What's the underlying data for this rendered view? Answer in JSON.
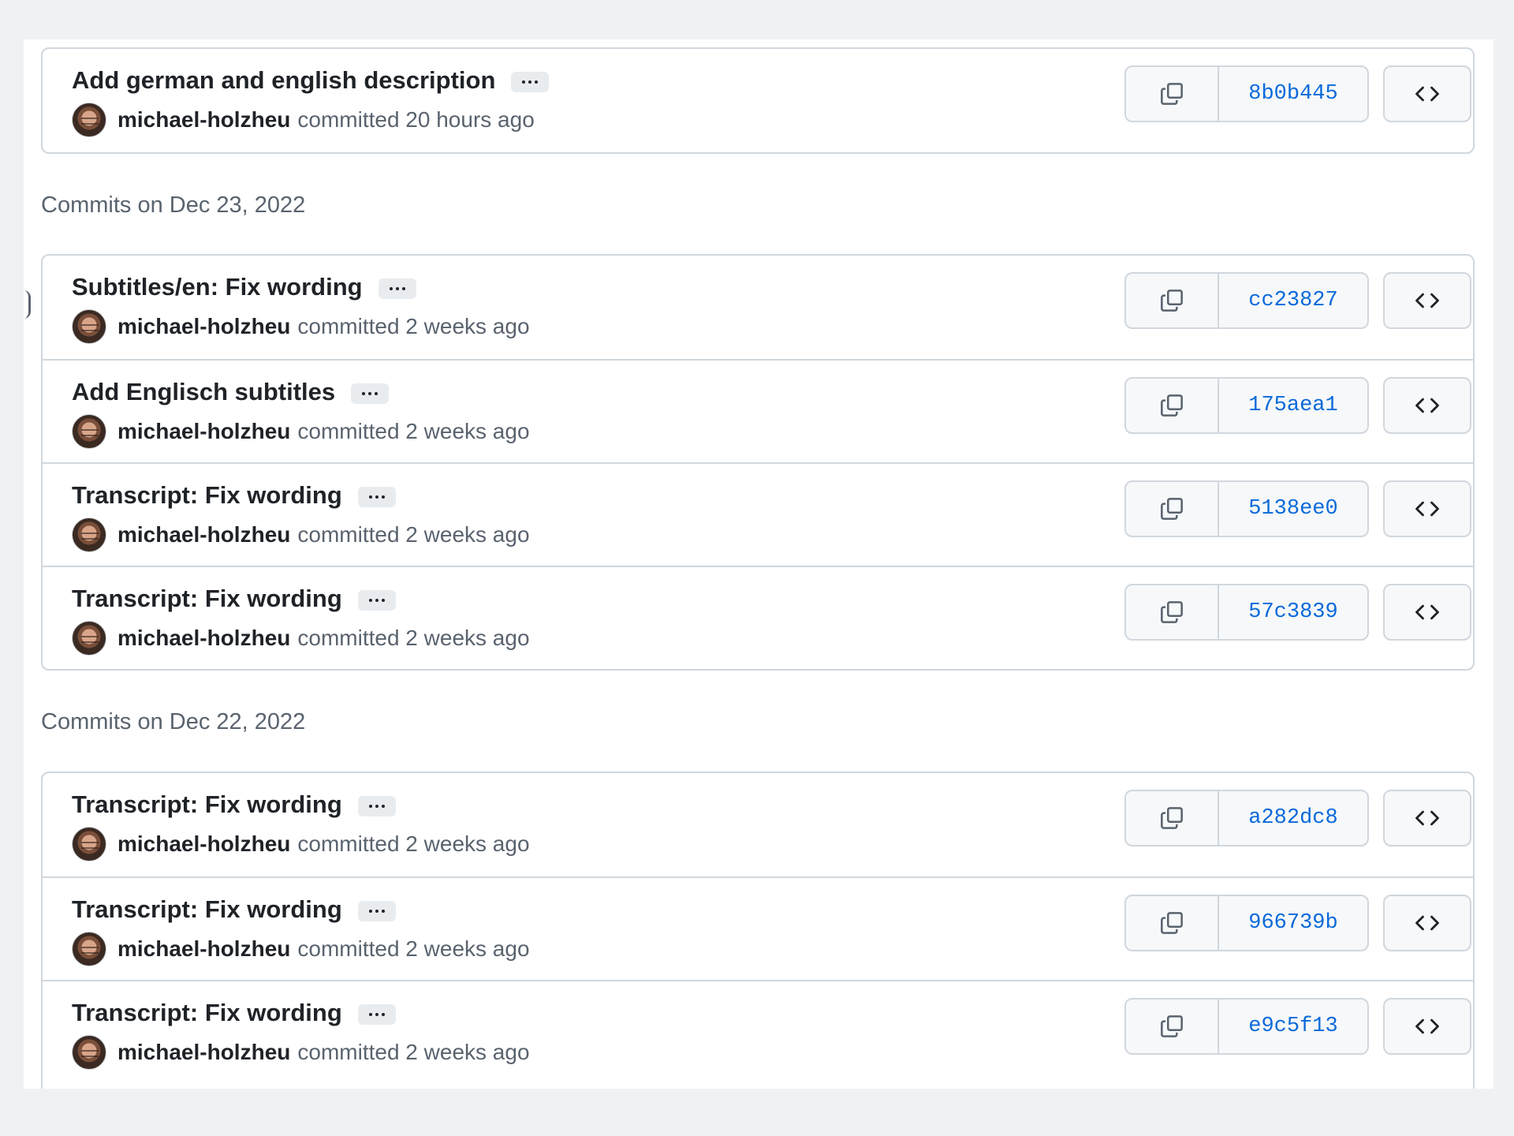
{
  "groups": [
    {
      "heading": "",
      "commits": [
        {
          "title": "Add german and english description",
          "author": "michael-holzheu",
          "time": "committed 20 hours ago",
          "sha": "8b0b445"
        }
      ]
    },
    {
      "heading": "Commits on Dec 23, 2022",
      "commits": [
        {
          "title": "Subtitles/en: Fix wording",
          "author": "michael-holzheu",
          "time": "committed 2 weeks ago",
          "sha": "cc23827"
        },
        {
          "title": "Add Englisch subtitles",
          "author": "michael-holzheu",
          "time": "committed 2 weeks ago",
          "sha": "175aea1"
        },
        {
          "title": "Transcript: Fix wording",
          "author": "michael-holzheu",
          "time": "committed 2 weeks ago",
          "sha": "5138ee0"
        },
        {
          "title": "Transcript: Fix wording",
          "author": "michael-holzheu",
          "time": "committed 2 weeks ago",
          "sha": "57c3839"
        }
      ]
    },
    {
      "heading": "Commits on Dec 22, 2022",
      "commits": [
        {
          "title": "Transcript: Fix wording",
          "author": "michael-holzheu",
          "time": "committed 2 weeks ago",
          "sha": "a282dc8"
        },
        {
          "title": "Transcript: Fix wording",
          "author": "michael-holzheu",
          "time": "committed 2 weeks ago",
          "sha": "966739b"
        },
        {
          "title": "Transcript: Fix wording",
          "author": "michael-holzheu",
          "time": "committed 2 weeks ago",
          "sha": "e9c5f13"
        }
      ]
    }
  ],
  "icons": {
    "expand": "ellipsis-icon",
    "copy": "copy-icon",
    "browse": "code-icon",
    "avatar": "avatar"
  },
  "colors": {
    "sha_link": "#0969da",
    "border": "#d0d7de",
    "button_bg": "#f6f8fa",
    "muted_text": "#59636e"
  }
}
